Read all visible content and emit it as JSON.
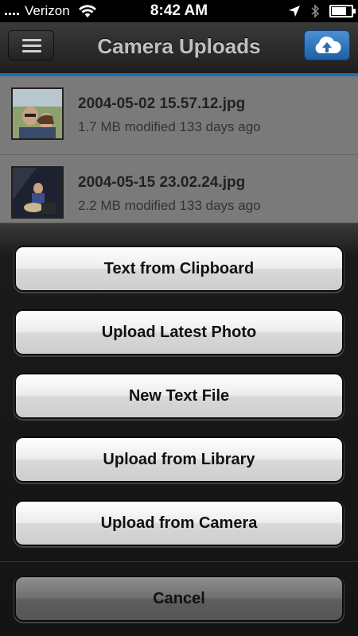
{
  "status": {
    "carrier": "Verizon",
    "time": "8:42 AM",
    "battery_level": 0.9
  },
  "header": {
    "title": "Camera Uploads",
    "menu_icon": "hamburger-menu-icon",
    "upload_icon": "cloud-upload-icon",
    "accent_color": "#1d6fb0"
  },
  "files": [
    {
      "name": "2004-05-02 15.57.12.jpg",
      "meta": "1.7 MB modified 133 days ago"
    },
    {
      "name": "2004-05-15 23.02.24.jpg",
      "meta": "2.2 MB modified 133 days ago"
    }
  ],
  "action_sheet": {
    "buttons": [
      "Text from Clipboard",
      "Upload Latest Photo",
      "New Text File",
      "Upload from Library",
      "Upload from Camera"
    ],
    "cancel": "Cancel"
  }
}
